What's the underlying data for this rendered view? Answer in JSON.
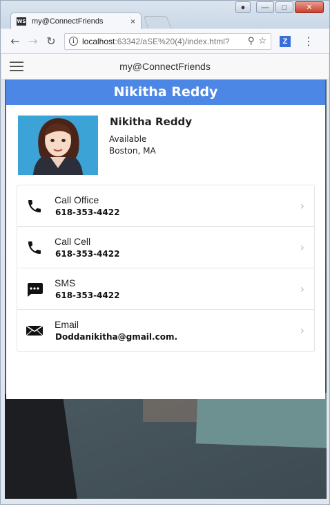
{
  "browser": {
    "tab_title": "my@ConnectFriends",
    "tab_favicon_text": "WS",
    "tab_close": "×",
    "url_host": "localhost",
    "url_path": ":63342/aSE%20(4)/index.html?",
    "ext_label": "Z",
    "window_controls": {
      "minimize": "—",
      "maximize": "□",
      "close": "✕"
    }
  },
  "app": {
    "title": "my@ConnectFriends"
  },
  "profile": {
    "header_name": "Nikitha Reddy",
    "name": "Nikitha Reddy",
    "status": "Available",
    "location": "Boston, MA"
  },
  "contacts": [
    {
      "label": "Call Office",
      "value": "618-353-4422",
      "icon": "phone-icon"
    },
    {
      "label": "Call Cell",
      "value": "618-353-4422",
      "icon": "phone-icon"
    },
    {
      "label": "SMS",
      "value": "618-353-4422",
      "icon": "sms-icon"
    },
    {
      "label": "Email",
      "value": "Doddanikitha@gmail.com.",
      "icon": "mail-icon"
    }
  ],
  "colors": {
    "header_blue": "#4d87e6",
    "avatar_bg": "#3ba3d6"
  }
}
